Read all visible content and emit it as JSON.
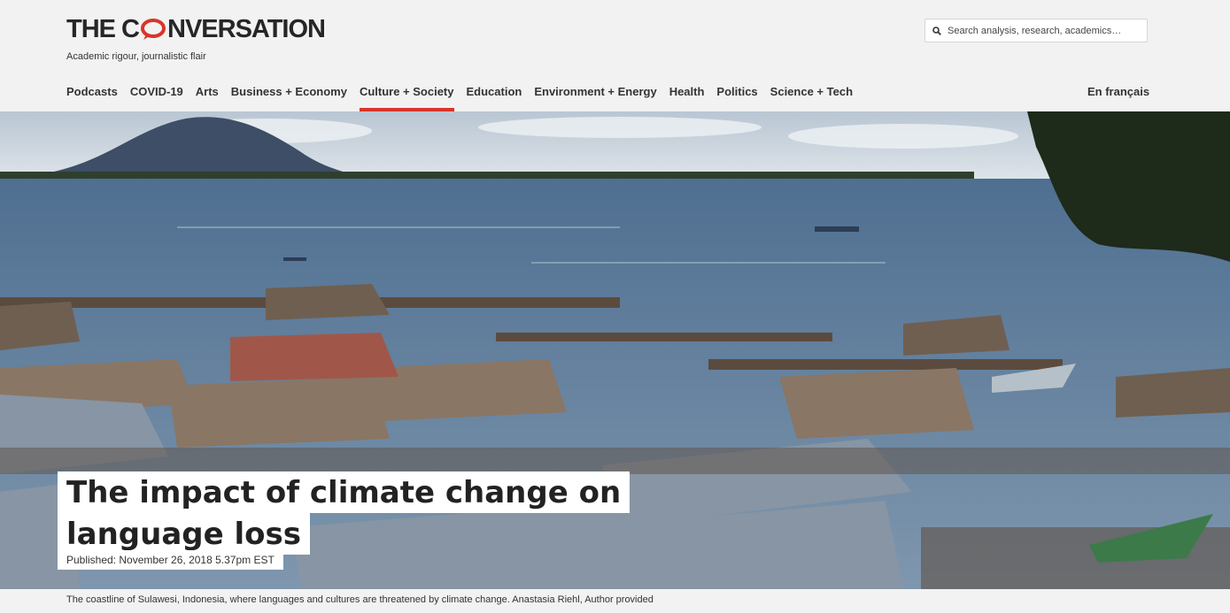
{
  "brand": {
    "logo_prefix": "THE C",
    "logo_suffix": "NVERSATION",
    "tagline": "Academic rigour, journalistic flair",
    "accent_color": "#d8352a"
  },
  "search": {
    "placeholder": "Search analysis, research, academics…",
    "icon": "search-icon"
  },
  "nav": {
    "items": [
      {
        "label": "Podcasts",
        "active": false
      },
      {
        "label": "COVID-19",
        "active": false
      },
      {
        "label": "Arts",
        "active": false
      },
      {
        "label": "Business + Economy",
        "active": false
      },
      {
        "label": "Culture + Society",
        "active": true
      },
      {
        "label": "Education",
        "active": false
      },
      {
        "label": "Environment + Energy",
        "active": false
      },
      {
        "label": "Health",
        "active": false
      },
      {
        "label": "Politics",
        "active": false
      },
      {
        "label": "Science + Tech",
        "active": false
      }
    ],
    "language_link": "En français"
  },
  "article": {
    "headline_line1": "The impact of climate change on",
    "headline_line2": "language loss",
    "published": "Published: November 26, 2018 5.37pm EST",
    "caption": "The coastline of Sulawesi, Indonesia, where languages and cultures are threatened by climate change. Anastasia Riehl, Author provided"
  }
}
